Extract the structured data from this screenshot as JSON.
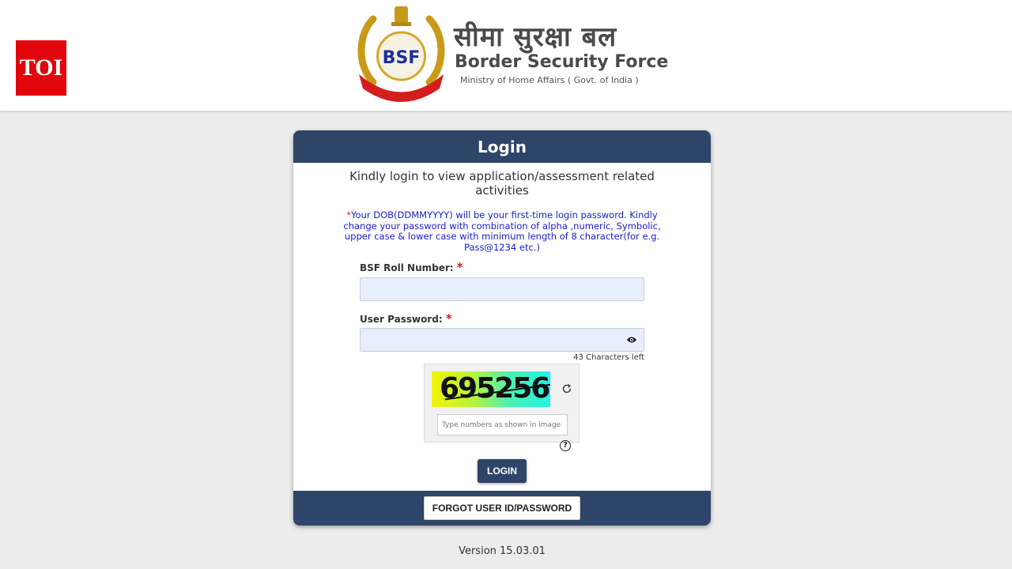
{
  "header": {
    "toi_logo": "TOI",
    "emblem_text": "BSF",
    "brand_hindi": "सीमा सुरक्षा बल",
    "brand_english": "Border Security Force",
    "brand_subtitle": "Ministry of Home Affairs ( Govt. of India )"
  },
  "login": {
    "title": "Login",
    "intro": "Kindly login to view application/assessment related activities",
    "notice_asterisk": "*",
    "notice": "Your DOB(DDMMYYYY) will be your first-time login password. Kindly change your password with combination of alpha ,numeric, Symbolic, upper case & lower case with minimum length of 8 character(for e.g. Pass@1234 etc.)",
    "roll_label": "BSF Roll Number:",
    "roll_value": "",
    "password_label": "User Password:",
    "password_value": "",
    "required_marker": "*",
    "chars_left": "43 Characters left",
    "captcha_code": "695256",
    "captcha_placeholder": "Type numbers as shown in image",
    "help_symbol": "?",
    "login_button": "LOGIN",
    "forgot_button": "FORGOT USER ID/PASSWORD"
  },
  "footer": {
    "version": "Version 15.03.01"
  },
  "colors": {
    "header_navy": "#2e4468",
    "toi_red": "#e1060d",
    "notice_blue": "#1a1acb",
    "required_red": "#e0141e"
  },
  "icons": [
    "eye-icon",
    "refresh-icon",
    "help-icon",
    "bsf-emblem"
  ]
}
